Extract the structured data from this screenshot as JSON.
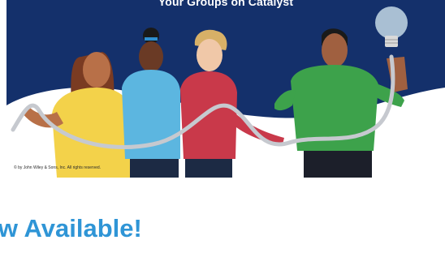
{
  "banner": {
    "title": "Your Groups on Catalyst",
    "copyright": "© by John Wiley & Sons, Inc. All rights reserved.",
    "colors": {
      "navy": "#14306b",
      "bulb": "#a9bfd3"
    },
    "icon": "lightbulb-icon"
  },
  "headline": {
    "text": "ow Available!",
    "color": "#2f95d6"
  }
}
